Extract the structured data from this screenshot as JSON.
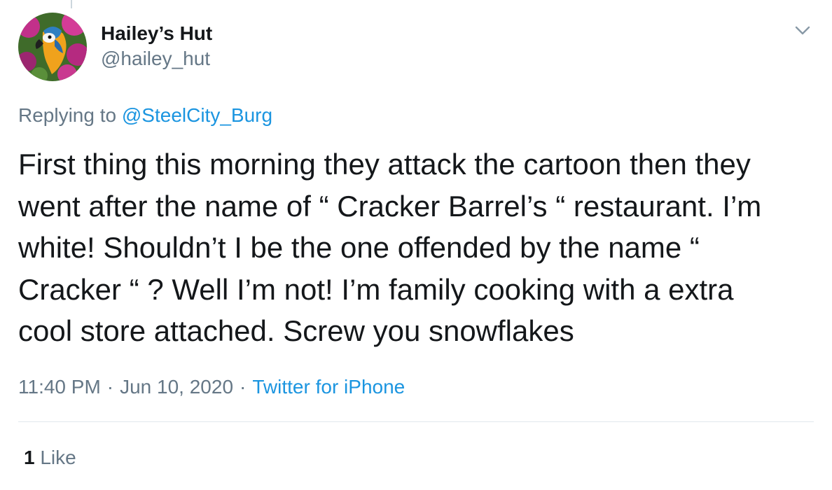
{
  "author": {
    "display_name": "Hailey’s Hut",
    "handle": "@hailey_hut",
    "avatar": "parrot-photo"
  },
  "reply": {
    "prefix": "Replying to",
    "mention": "@SteelCity_Burg"
  },
  "tweet": {
    "lines": [
      "First thing this morning they attack the cartoon then they",
      "went after the name of “ Cracker Barrel’s “ restaurant. I’m",
      "white! Shouldn’t I be the one offended by the name “",
      "Cracker “ ? Well I’m not! I’m family cooking with a extra",
      "cool store attached. Screw you snowflakes"
    ]
  },
  "meta": {
    "time": "11:40 PM",
    "separator": "·",
    "date": "Jun 10, 2020",
    "source": "Twitter for iPhone"
  },
  "stats": {
    "likes_count": "1",
    "likes_label": "Like"
  },
  "icons": {
    "menu": "chevron-down-icon"
  },
  "colors": {
    "text": "#14171a",
    "secondary": "#657786",
    "link": "#1b95e0",
    "divider": "#e1e8ed"
  }
}
